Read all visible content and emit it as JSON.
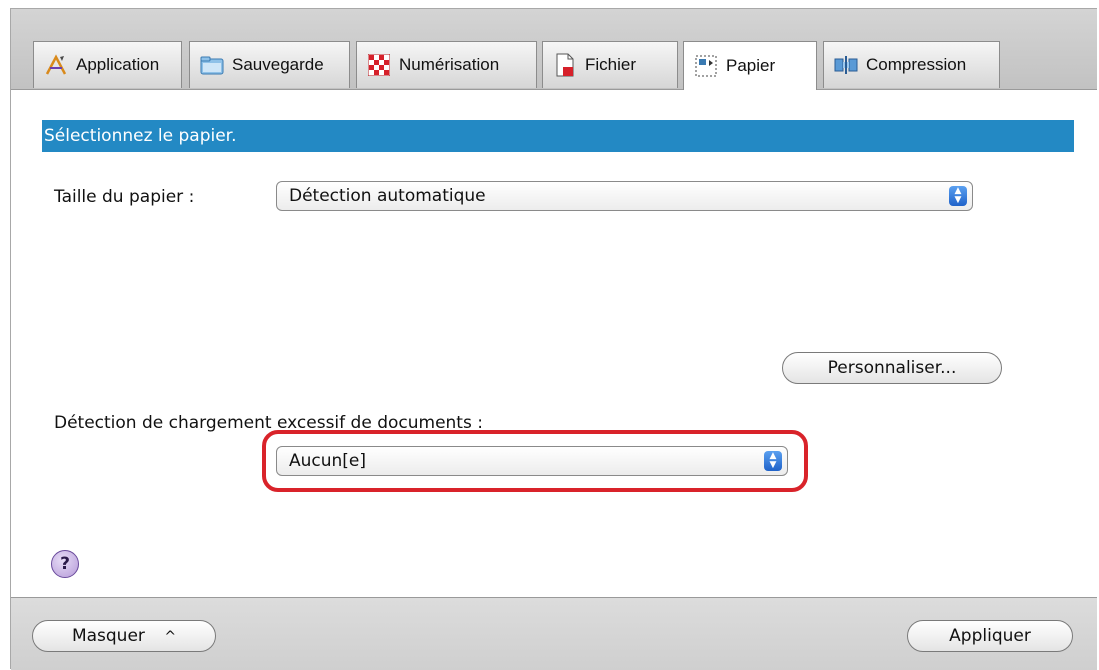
{
  "tabs": [
    {
      "label": "Application",
      "icon": "application-icon"
    },
    {
      "label": "Sauvegarde",
      "icon": "folder-icon"
    },
    {
      "label": "Numérisation",
      "icon": "scan-icon"
    },
    {
      "label": "Fichier",
      "icon": "file-icon"
    },
    {
      "label": "Papier",
      "icon": "paper-icon",
      "active": true
    },
    {
      "label": "Compression",
      "icon": "compression-icon"
    }
  ],
  "section": {
    "title": "Sélectionnez le papier."
  },
  "paper_size": {
    "label": "Taille du papier :",
    "value": "Détection automatique"
  },
  "customize_button": "Personnaliser...",
  "overload": {
    "label": "Détection de chargement excessif de documents :",
    "value": "Aucun[e]"
  },
  "help": {
    "glyph": "?"
  },
  "footer": {
    "hide_button": "Masquer",
    "hide_chevron": "^",
    "apply_button": "Appliquer"
  },
  "colors": {
    "section_bar": "#2389c4",
    "highlight": "#d9232a"
  }
}
